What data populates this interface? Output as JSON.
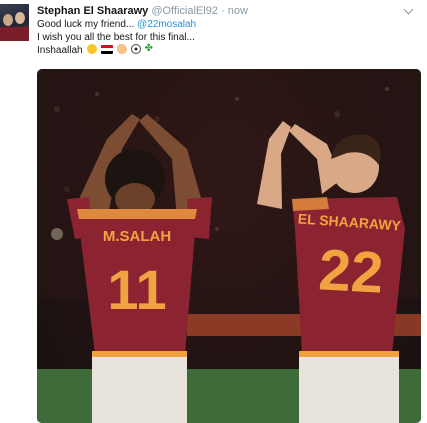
{
  "tweet": {
    "author_name": "Stephan El Shaarawy",
    "author_handle": "@OfficialEl92",
    "separator": "·",
    "time": "now",
    "lines": {
      "line1_prefix": "Good luck my friend... ",
      "line1_mention": "@22mosalah",
      "line2": "I wish you all the best for this final...",
      "line3": "Inshaallah"
    },
    "emojis": [
      "smiling-face",
      "egypt-flag",
      "flexed-biceps",
      "soccer-ball",
      "four-leaf-clover"
    ]
  },
  "photo": {
    "player_left": {
      "name": "M.SALAH",
      "number": "11"
    },
    "player_right": {
      "name": "EL SHAARAWY",
      "number": "22"
    }
  },
  "colors": {
    "name": "#14171a",
    "meta": "#8899a6",
    "mention": "#1b95e0",
    "jersey": "#8b2430",
    "jersey_text": "#f2a341"
  }
}
